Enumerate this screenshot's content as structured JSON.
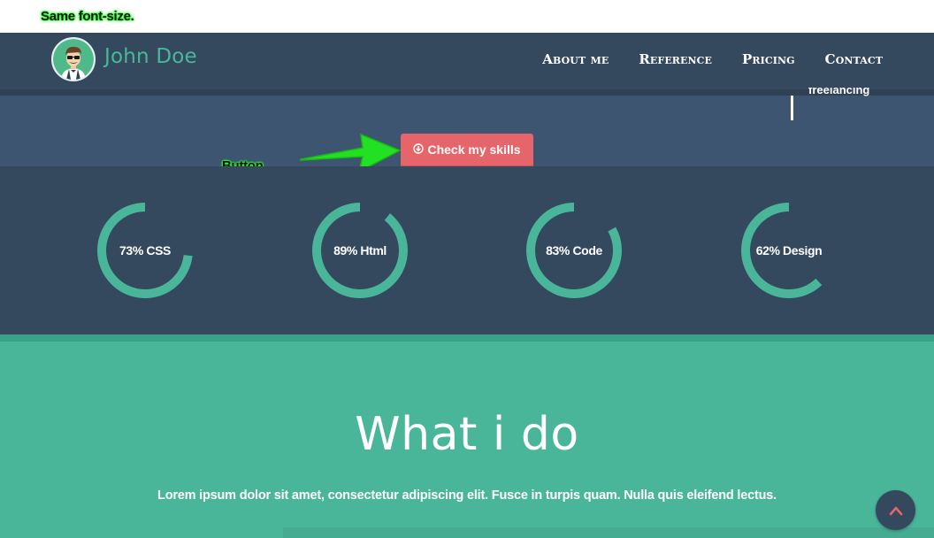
{
  "annotations": {
    "font_note": "Same font-size.",
    "button_note": "Button"
  },
  "navbar": {
    "brand": "John Doe",
    "links": [
      "About me",
      "Reference",
      "Pricing",
      "Contact"
    ]
  },
  "hero": {
    "partial_text": "freelancing",
    "button_label": "Check my skills",
    "button_icon": "circle-arrow-down-icon"
  },
  "skills": [
    {
      "label": "73% CSS",
      "percent": 73
    },
    {
      "label": "89% Html",
      "percent": 89
    },
    {
      "label": "83% Code",
      "percent": 83
    },
    {
      "label": "62% Design",
      "percent": 62
    }
  ],
  "section": {
    "title": "What i do",
    "text": "Lorem ipsum dolor sit amet, consectetur adipiscing elit. Fusce in turpis quam. Nulla quis eleifend lectus."
  },
  "colors": {
    "navy": "#34495e",
    "accent_green": "#49b69a",
    "button_red": "#e5656a",
    "annotation_green": "#2aff2a"
  }
}
